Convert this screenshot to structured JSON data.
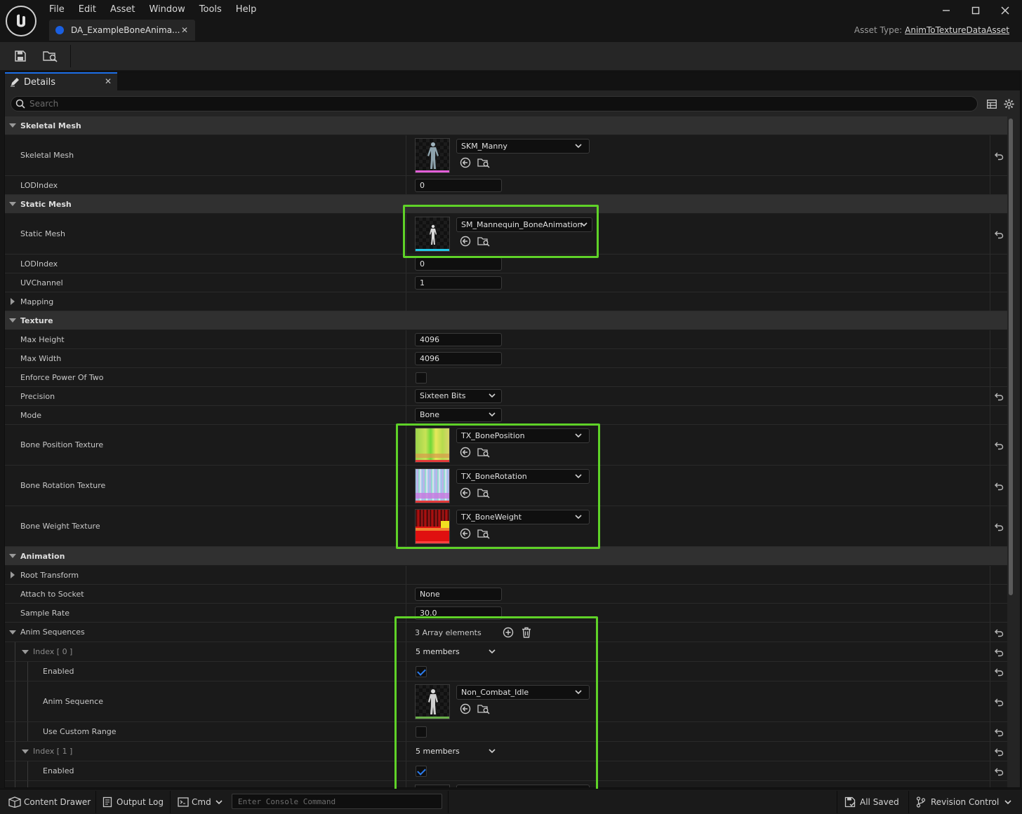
{
  "menu": [
    "File",
    "Edit",
    "Asset",
    "Window",
    "Tools",
    "Help"
  ],
  "document_tab": {
    "label": "DA_ExampleBoneAnima..."
  },
  "asset_type": {
    "label": "Asset Type:",
    "value": "AnimToTextureDataAsset"
  },
  "details": {
    "tab_label": "Details",
    "search_placeholder": "Search",
    "skeletal_mesh": {
      "header": "Skeletal Mesh",
      "mesh_label": "Skeletal Mesh",
      "mesh_value": "SKM_Manny",
      "lod_label": "LODIndex",
      "lod_value": "0"
    },
    "static_mesh": {
      "header": "Static Mesh",
      "mesh_label": "Static Mesh",
      "mesh_value": "SM_Mannequin_BoneAnimation",
      "lod_label": "LODIndex",
      "lod_value": "0",
      "uv_label": "UVChannel",
      "uv_value": "1",
      "mapping_label": "Mapping"
    },
    "texture": {
      "header": "Texture",
      "max_height_label": "Max Height",
      "max_height_value": "4096",
      "max_width_label": "Max Width",
      "max_width_value": "4096",
      "enforce_label": "Enforce Power Of Two",
      "precision_label": "Precision",
      "precision_value": "Sixteen Bits",
      "mode_label": "Mode",
      "mode_value": "Bone",
      "bone_position_label": "Bone Position Texture",
      "bone_position_value": "TX_BonePosition",
      "bone_rotation_label": "Bone Rotation Texture",
      "bone_rotation_value": "TX_BoneRotation",
      "bone_weight_label": "Bone Weight Texture",
      "bone_weight_value": "TX_BoneWeight"
    },
    "animation": {
      "header": "Animation",
      "root_transform_label": "Root Transform",
      "attach_label": "Attach to Socket",
      "attach_value": "None",
      "sample_rate_label": "Sample Rate",
      "sample_rate_value": "30.0",
      "anim_sequences_label": "Anim Sequences",
      "anim_sequences_value": "3 Array elements",
      "index0_label": "Index [ 0 ]",
      "index0_value": "5 members",
      "enabled_label": "Enabled",
      "anim_sequence_label": "Anim Sequence",
      "anim_sequence_value": "Non_Combat_Idle",
      "use_custom_range_label": "Use Custom Range",
      "index1_label": "Index [ 1 ]",
      "index1_value": "5 members",
      "enabled1_label": "Enabled"
    }
  },
  "statusbar": {
    "content_drawer": "Content Drawer",
    "output_log": "Output Log",
    "cmd": "Cmd",
    "console_placeholder": "Enter Console Command",
    "all_saved": "All Saved",
    "revision_control": "Revision Control"
  },
  "colors": {
    "highlight": "#5fd228",
    "accent": "#1d6fe8"
  }
}
